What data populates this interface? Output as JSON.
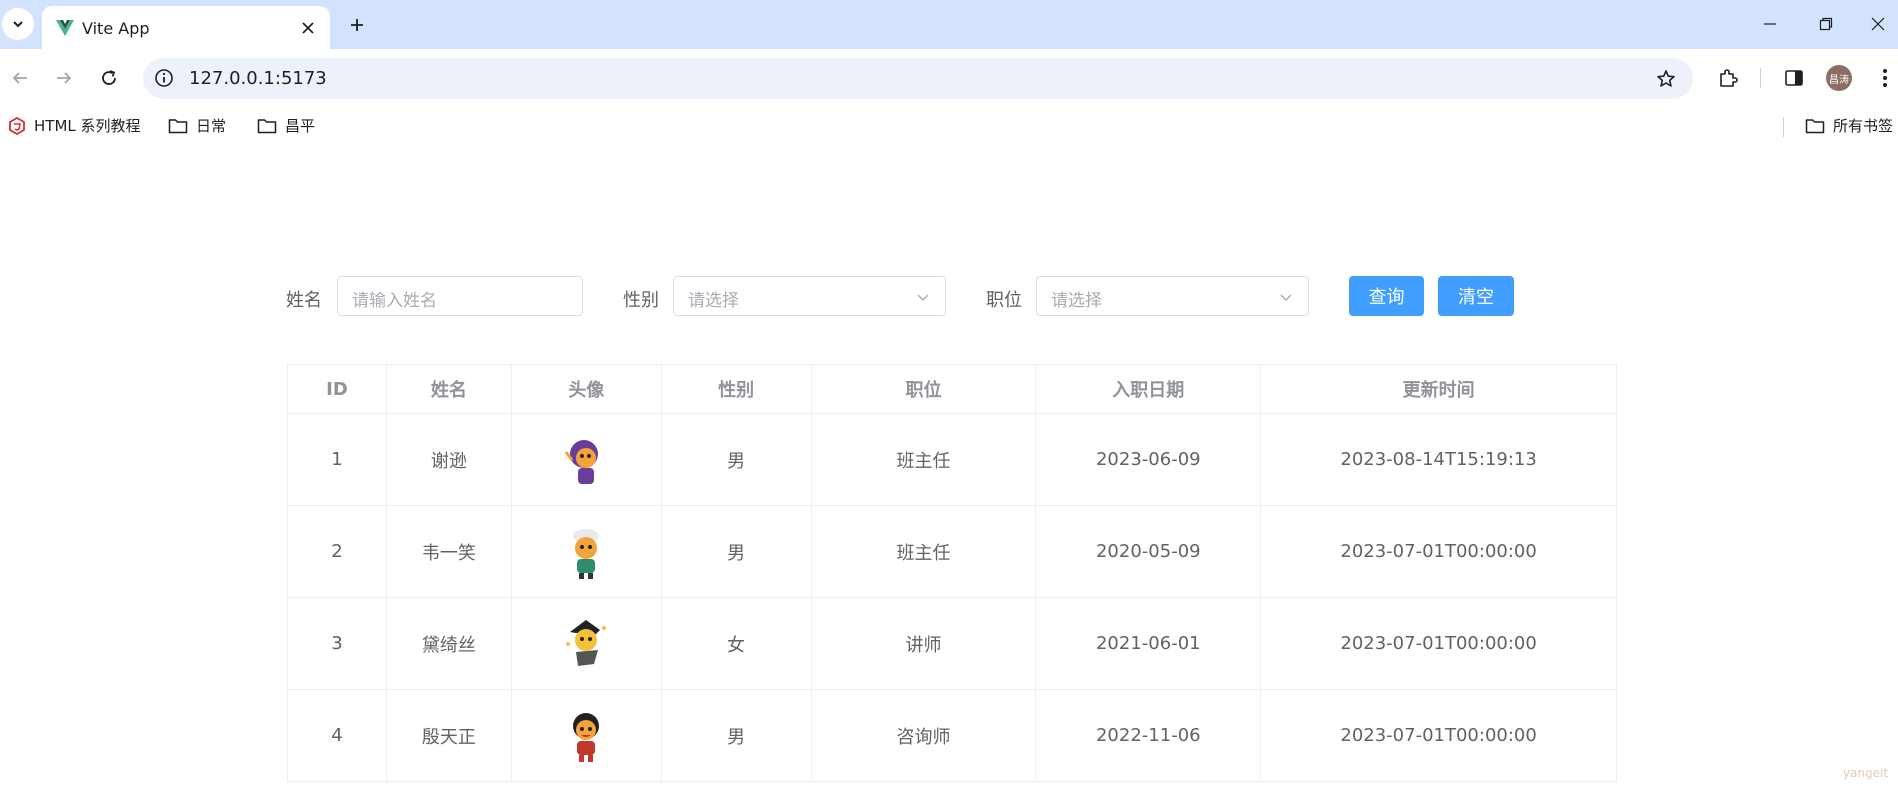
{
  "browser": {
    "tab_title": "Vite App",
    "url": "127.0.0.1:5173",
    "profile_initials": "昌涛",
    "bookmarks": [
      {
        "label": "HTML 系列教程",
        "icon": "html-logo-icon"
      },
      {
        "label": "日常",
        "icon": "folder-icon"
      },
      {
        "label": "昌平",
        "icon": "folder-icon"
      }
    ],
    "all_bookmarks_label": "所有书签"
  },
  "filters": {
    "name_label": "姓名",
    "name_placeholder": "请输入姓名",
    "gender_label": "性别",
    "gender_placeholder": "请选择",
    "job_label": "职位",
    "job_placeholder": "请选择",
    "query_button": "查询",
    "clear_button": "清空"
  },
  "table": {
    "headers": [
      "ID",
      "姓名",
      "头像",
      "性别",
      "职位",
      "入职日期",
      "更新时间"
    ],
    "rows": [
      {
        "id": "1",
        "name": "谢逊",
        "gender": "男",
        "job": "班主任",
        "entry_date": "2023-06-09",
        "update_time": "2023-08-14T15:19:13"
      },
      {
        "id": "2",
        "name": "韦一笑",
        "gender": "男",
        "job": "班主任",
        "entry_date": "2020-05-09",
        "update_time": "2023-07-01T00:00:00"
      },
      {
        "id": "3",
        "name": "黛绮丝",
        "gender": "女",
        "job": "讲师",
        "entry_date": "2021-06-01",
        "update_time": "2023-07-01T00:00:00"
      },
      {
        "id": "4",
        "name": "殷天正",
        "gender": "男",
        "job": "咨询师",
        "entry_date": "2022-11-06",
        "update_time": "2023-07-01T00:00:00"
      }
    ]
  },
  "watermark": "yangeit",
  "colors": {
    "primary": "#409eff",
    "chrome_bg": "#d3e3fd",
    "omnibox_bg": "#edf2fa"
  }
}
